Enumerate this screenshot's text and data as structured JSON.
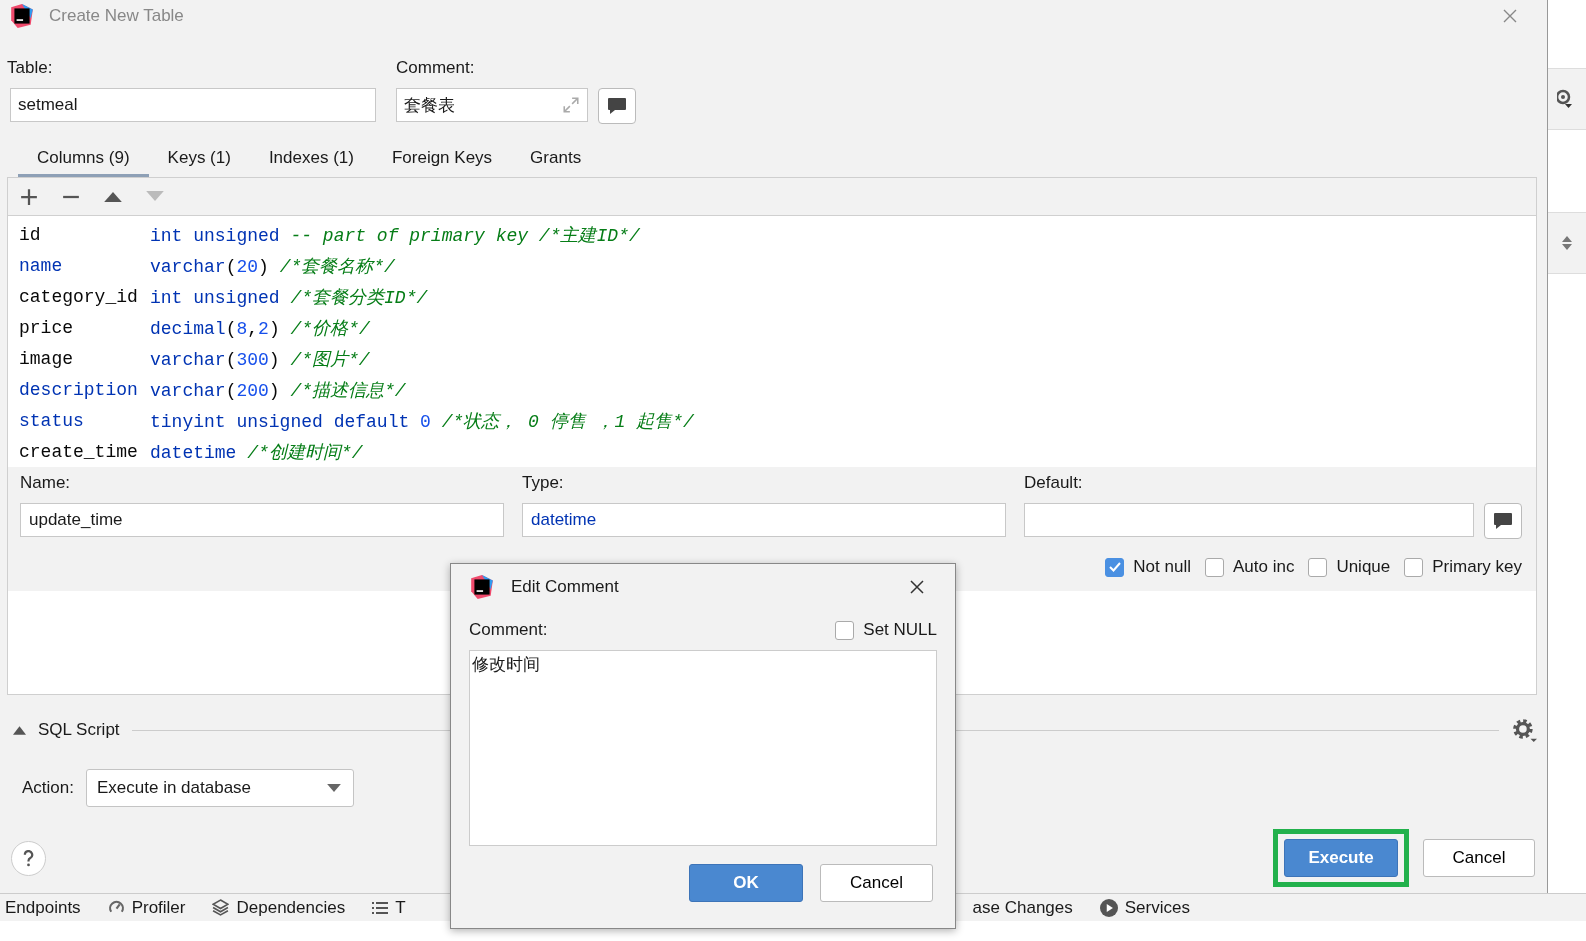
{
  "window": {
    "title": "Create New Table"
  },
  "table_field": {
    "label": "Table:",
    "value": "setmeal"
  },
  "comment_field": {
    "label": "Comment:",
    "value": "套餐表"
  },
  "tabs": [
    {
      "label": "Columns (9)",
      "selected": true
    },
    {
      "label": "Keys (1)",
      "selected": false
    },
    {
      "label": "Indexes (1)",
      "selected": false
    },
    {
      "label": "Foreign Keys",
      "selected": false
    },
    {
      "label": "Grants",
      "selected": false
    }
  ],
  "columns": [
    {
      "name": "id",
      "keyword": false,
      "definition": [
        {
          "kind": "type",
          "text": "int unsigned"
        },
        {
          "kind": "comment",
          "text": " -- part of primary key /*主建ID*/"
        }
      ]
    },
    {
      "name": "name",
      "keyword": true,
      "definition": [
        {
          "kind": "type",
          "text": "varchar"
        },
        {
          "kind": "plain",
          "text": "("
        },
        {
          "kind": "number",
          "text": "20"
        },
        {
          "kind": "plain",
          "text": ")"
        },
        {
          "kind": "comment",
          "text": " /*套餐名称*/"
        }
      ]
    },
    {
      "name": "category_id",
      "keyword": false,
      "definition": [
        {
          "kind": "type",
          "text": "int unsigned"
        },
        {
          "kind": "comment",
          "text": " /*套餐分类ID*/"
        }
      ]
    },
    {
      "name": "price",
      "keyword": false,
      "definition": [
        {
          "kind": "type",
          "text": "decimal"
        },
        {
          "kind": "plain",
          "text": "("
        },
        {
          "kind": "number",
          "text": "8"
        },
        {
          "kind": "plain",
          "text": ","
        },
        {
          "kind": "number",
          "text": "2"
        },
        {
          "kind": "plain",
          "text": ")"
        },
        {
          "kind": "comment",
          "text": " /*价格*/"
        }
      ]
    },
    {
      "name": "image",
      "keyword": false,
      "definition": [
        {
          "kind": "type",
          "text": "varchar"
        },
        {
          "kind": "plain",
          "text": "("
        },
        {
          "kind": "number",
          "text": "300"
        },
        {
          "kind": "plain",
          "text": ")"
        },
        {
          "kind": "comment",
          "text": " /*图片*/"
        }
      ]
    },
    {
      "name": "description",
      "keyword": true,
      "definition": [
        {
          "kind": "type",
          "text": "varchar"
        },
        {
          "kind": "plain",
          "text": "("
        },
        {
          "kind": "number",
          "text": "200"
        },
        {
          "kind": "plain",
          "text": ")"
        },
        {
          "kind": "comment",
          "text": " /*描述信息*/"
        }
      ]
    },
    {
      "name": "status",
      "keyword": true,
      "definition": [
        {
          "kind": "type",
          "text": "tinyint unsigned default "
        },
        {
          "kind": "number",
          "text": "0"
        },
        {
          "kind": "comment",
          "text": " /*状态， 0 停售 ，1 起售*/"
        }
      ]
    },
    {
      "name": "create_time",
      "keyword": false,
      "definition": [
        {
          "kind": "type",
          "text": "datetime"
        },
        {
          "kind": "comment",
          "text": " /*创建时间*/"
        }
      ]
    }
  ],
  "column_editor": {
    "name_label": "Name:",
    "name_value": "update_time",
    "type_label": "Type:",
    "type_value": "datetime",
    "default_label": "Default:",
    "options": [
      {
        "label": "Not null",
        "checked": true
      },
      {
        "label": "Auto inc",
        "checked": false
      },
      {
        "label": "Unique",
        "checked": false
      },
      {
        "label": "Primary key",
        "checked": false
      }
    ]
  },
  "sql_script": {
    "title": "SQL Script",
    "expanded": true,
    "action_label": "Action:",
    "action_value": "Execute in database"
  },
  "buttons": {
    "execute": "Execute",
    "cancel": "Cancel"
  },
  "tool_windows": [
    {
      "label": "Endpoints",
      "kind": "plain"
    },
    {
      "label": "Profiler",
      "kind": "profiler"
    },
    {
      "label": "Dependencies",
      "kind": "layers"
    },
    {
      "label": "T",
      "kind": "list"
    },
    {
      "label": "ase Changes",
      "kind": "cut"
    },
    {
      "label": "Services",
      "kind": "play"
    }
  ],
  "edit_comment": {
    "title": "Edit Comment",
    "label": "Comment:",
    "set_null_label": "Set NULL",
    "set_null": false,
    "text": "修改时间",
    "ok": "OK",
    "cancel": "Cancel"
  }
}
